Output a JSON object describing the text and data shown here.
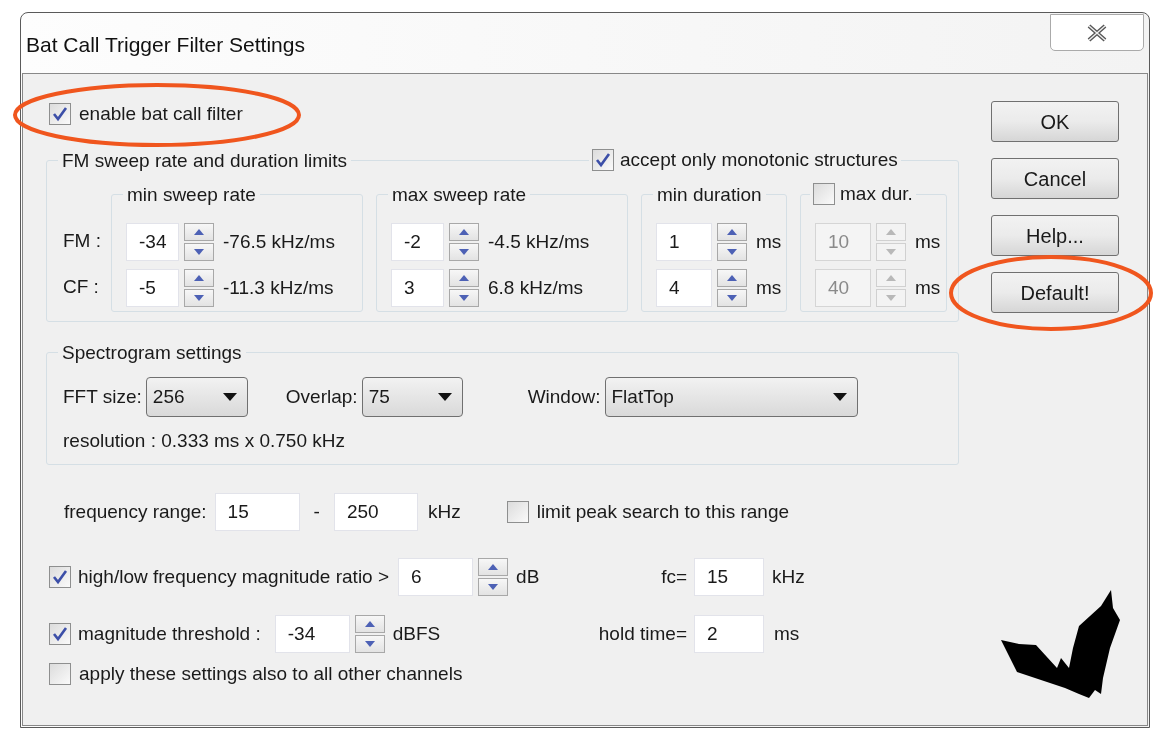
{
  "window": {
    "title": "Bat Call Trigger Filter Settings"
  },
  "enable_filter": {
    "label": "enable bat call filter",
    "checked": true
  },
  "sweep_group": {
    "title": "FM sweep rate and duration limits",
    "monotonic": {
      "label": "accept only monotonic structures",
      "checked": true
    },
    "row_labels": [
      "FM :",
      "CF :"
    ],
    "subgroups": [
      {
        "kind": "plain",
        "title": "min sweep rate",
        "disabled": false,
        "fields": [
          {
            "value": "-34",
            "reading": "-76.5 kHz/ms"
          },
          {
            "value": "-5",
            "reading": "-11.3 kHz/ms"
          }
        ]
      },
      {
        "kind": "plain",
        "title": "max sweep rate",
        "disabled": false,
        "fields": [
          {
            "value": "-2",
            "reading": "-4.5 kHz/ms"
          },
          {
            "value": "3",
            "reading": "6.8 kHz/ms"
          }
        ]
      },
      {
        "kind": "plain",
        "title": "min duration",
        "disabled": false,
        "fields": [
          {
            "value": "1",
            "reading": "ms"
          },
          {
            "value": "4",
            "reading": "ms"
          }
        ]
      },
      {
        "kind": "checkbox",
        "title": "max dur.",
        "checked": false,
        "disabled": true,
        "fields": [
          {
            "value": "10",
            "reading": "ms"
          },
          {
            "value": "40",
            "reading": "ms"
          }
        ]
      }
    ]
  },
  "spectrogram": {
    "title": "Spectrogram settings",
    "dropdowns": [
      {
        "label": "FFT size:",
        "value": "256"
      },
      {
        "label": "Overlap:",
        "value": "75"
      },
      {
        "label": "Window:",
        "value": "FlatTop"
      }
    ],
    "resolution": "resolution : 0.333 ms x 0.750 kHz"
  },
  "frequency_range": {
    "label": "frequency range:",
    "from": "15",
    "separator": "-",
    "to": "250",
    "unit": "kHz",
    "limit": {
      "label": "limit peak search to this range",
      "checked": false
    }
  },
  "ratio": {
    "label": "high/low frequency magnitude ratio >",
    "checked": true,
    "value": "6",
    "unit": "dB",
    "fc_label": "fc=",
    "fc_value": "15",
    "fc_unit": "kHz"
  },
  "threshold": {
    "label": "magnitude threshold :",
    "checked": true,
    "value": "-34",
    "unit": "dBFS",
    "hold_label": "hold time=",
    "hold_value": "2",
    "hold_unit": "ms"
  },
  "apply_all": {
    "label": "apply these settings also to all other channels",
    "checked": false
  },
  "buttons": [
    {
      "label": "OK"
    },
    {
      "label": "Cancel"
    },
    {
      "label": "Help..."
    },
    {
      "label": "Default!"
    }
  ]
}
